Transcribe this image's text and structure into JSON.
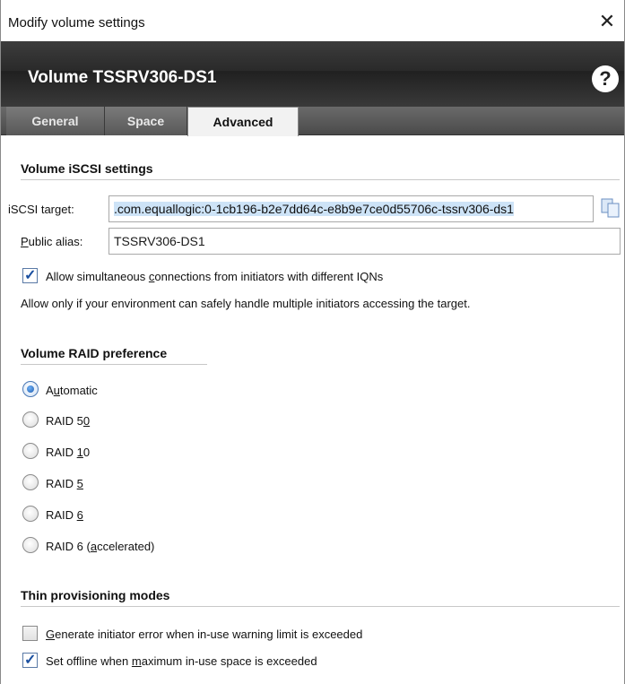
{
  "window": {
    "title": "Modify volume settings",
    "close_glyph": "✕"
  },
  "header": {
    "volume_title": "Volume TSSRV306-DS1",
    "help_glyph": "?"
  },
  "tabs": [
    {
      "label": "General",
      "active": false
    },
    {
      "label": "Space",
      "active": false
    },
    {
      "label": "Advanced",
      "active": true
    }
  ],
  "iscsi": {
    "section_title": "Volume iSCSI settings",
    "target_label": "iSCSI target:",
    "target_value": ".com.equallogic:0-1cb196-b2e7dd64c-e8b9e7ce0d55706c-tssrv306-ds1",
    "alias_label_prefix": "",
    "alias_label_mnemonic": "P",
    "alias_label_rest": "ublic alias:",
    "alias_value": "TSSRV306-DS1",
    "allow_multi": {
      "checked": true,
      "label_pre": "Allow simultaneous ",
      "label_mnemonic": "c",
      "label_post": "onnections from initiators with different IQNs"
    },
    "note": "Allow only if your environment can safely handle multiple initiators accessing the target."
  },
  "raid": {
    "section_title": "Volume RAID preference",
    "options": [
      {
        "pre": "A",
        "mn": "u",
        "post": "tomatic",
        "selected": true
      },
      {
        "pre": "RAID 5",
        "mn": "0",
        "post": "",
        "selected": false
      },
      {
        "pre": "RAID ",
        "mn": "1",
        "post": "0",
        "selected": false
      },
      {
        "pre": "RAID ",
        "mn": "5",
        "post": "",
        "selected": false
      },
      {
        "pre": "RAID ",
        "mn": "6",
        "post": "",
        "selected": false
      },
      {
        "pre": "RAID 6 (",
        "mn": "a",
        "post": "ccelerated)",
        "selected": false
      }
    ]
  },
  "thin": {
    "section_title": "Thin provisioning modes",
    "options": [
      {
        "pre": "",
        "mn": "G",
        "post": "enerate initiator error when in-use warning limit is exceeded",
        "checked": false
      },
      {
        "pre": "Set offline when ",
        "mn": "m",
        "post": "aximum in-use space is exceeded",
        "checked": true
      }
    ]
  },
  "icons": {
    "copy": "copy-icon",
    "close": "close-icon",
    "help": "help-icon"
  },
  "colors": {
    "header_dark": "#2a2a2a",
    "selection_highlight": "#cde3f7",
    "accent_blue": "#1e5db0"
  }
}
